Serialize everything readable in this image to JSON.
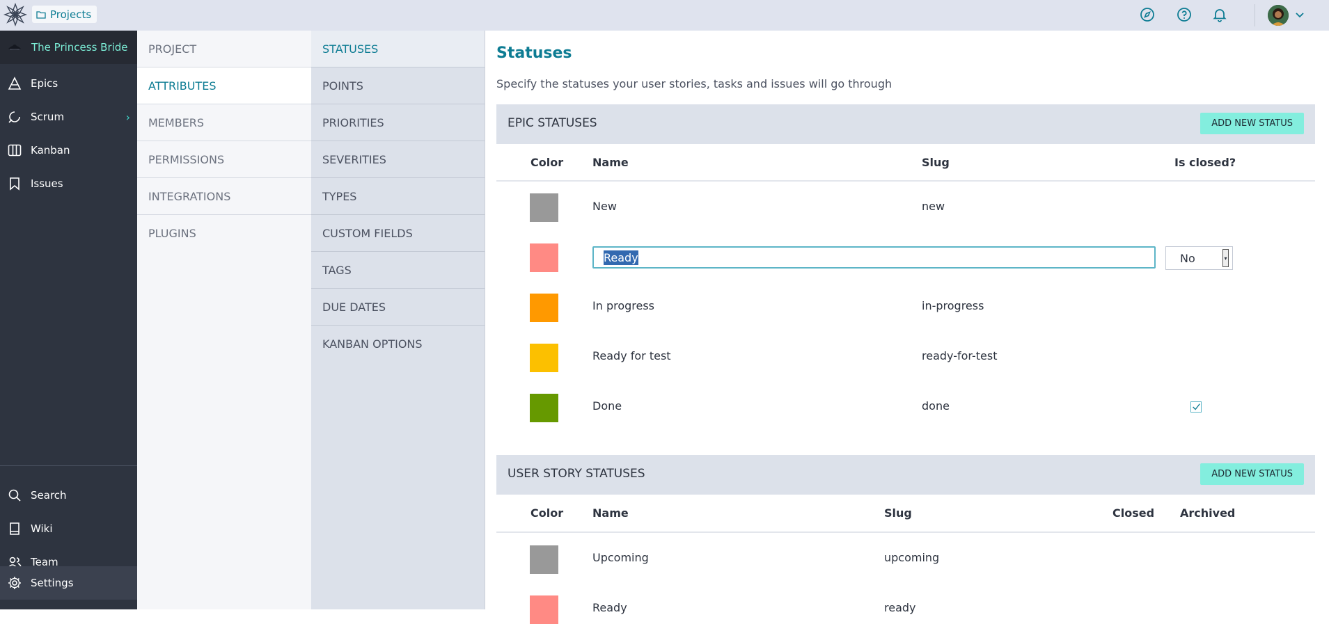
{
  "topbar": {
    "projects_label": "Projects",
    "icons": [
      "taiga-logo-icon",
      "folder-icon",
      "compass-icon",
      "help-icon",
      "bell-icon",
      "avatar",
      "chevron-down-icon"
    ]
  },
  "sidebar": {
    "project_name": "The Princess Bride",
    "items": [
      {
        "label": "Epics",
        "icon": "epics-icon"
      },
      {
        "label": "Scrum",
        "icon": "scrum-icon"
      },
      {
        "label": "Kanban",
        "icon": "kanban-icon"
      },
      {
        "label": "Issues",
        "icon": "issues-icon"
      }
    ],
    "bottom_items": [
      {
        "label": "Search",
        "icon": "search-icon"
      },
      {
        "label": "Wiki",
        "icon": "wiki-icon"
      },
      {
        "label": "Team",
        "icon": "team-icon"
      },
      {
        "label": "Settings",
        "icon": "gear-icon"
      }
    ]
  },
  "nav1": [
    "PROJECT",
    "ATTRIBUTES",
    "MEMBERS",
    "PERMISSIONS",
    "INTEGRATIONS",
    "PLUGINS"
  ],
  "nav2": [
    "STATUSES",
    "POINTS",
    "PRIORITIES",
    "SEVERITIES",
    "TYPES",
    "CUSTOM FIELDS",
    "TAGS",
    "DUE DATES",
    "KANBAN OPTIONS"
  ],
  "main": {
    "title": "Statuses",
    "description": "Specify the statuses your user stories, tasks and issues will go through",
    "epic_section": {
      "title": "EPIC STATUSES",
      "add_label": "ADD NEW STATUS",
      "columns": {
        "color": "Color",
        "name": "Name",
        "slug": "Slug",
        "closed": "Is closed?"
      },
      "rows": [
        {
          "color": "#999999",
          "name": "New",
          "slug": "new",
          "closed": false
        },
        {
          "color": "#ff8a84",
          "name": "Ready",
          "slug": "",
          "closed": false,
          "editing": true,
          "closed_select": "No"
        },
        {
          "color": "#ff9900",
          "name": "In progress",
          "slug": "in-progress",
          "closed": false
        },
        {
          "color": "#fcc000",
          "name": "Ready for test",
          "slug": "ready-for-test",
          "closed": false
        },
        {
          "color": "#669900",
          "name": "Done",
          "slug": "done",
          "closed": true
        }
      ]
    },
    "us_section": {
      "title": "USER STORY STATUSES",
      "add_label": "ADD NEW STATUS",
      "columns": {
        "color": "Color",
        "name": "Name",
        "slug": "Slug",
        "closed": "Closed",
        "archived": "Archived"
      },
      "rows": [
        {
          "color": "#999999",
          "name": "Upcoming",
          "slug": "upcoming"
        },
        {
          "color": "#ff8a84",
          "name": "Ready",
          "slug": "ready"
        }
      ]
    }
  }
}
